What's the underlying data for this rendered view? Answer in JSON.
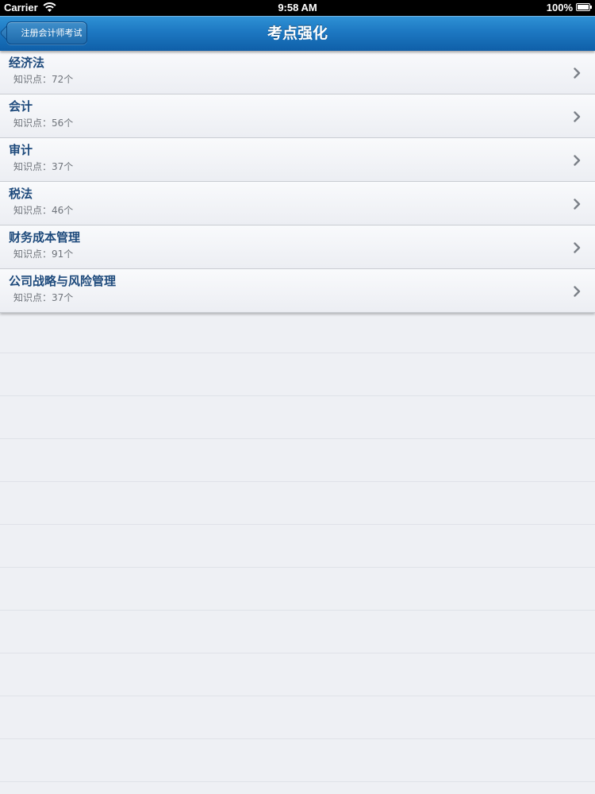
{
  "status_bar": {
    "carrier": "Carrier",
    "time": "9:58 AM",
    "battery": "100%"
  },
  "nav": {
    "back_label": "注册会计师考试",
    "title": "考点强化"
  },
  "items": [
    {
      "title": "经济法",
      "subtitle": "知识点：72个"
    },
    {
      "title": "会计",
      "subtitle": "知识点：56个"
    },
    {
      "title": "审计",
      "subtitle": "知识点：37个"
    },
    {
      "title": "税法",
      "subtitle": "知识点：46个"
    },
    {
      "title": "财务成本管理",
      "subtitle": "知识点：91个"
    },
    {
      "title": "公司战略与风险管理",
      "subtitle": "知识点：37个"
    }
  ],
  "icons": {
    "wifi": "wifi-icon",
    "battery": "battery-icon",
    "chevron": "chevron-right-icon"
  },
  "colors": {
    "nav_bar": "#1d78c2",
    "item_title": "#1e4a7c",
    "item_subtitle": "#6f747b",
    "background": "#eef0f4"
  }
}
